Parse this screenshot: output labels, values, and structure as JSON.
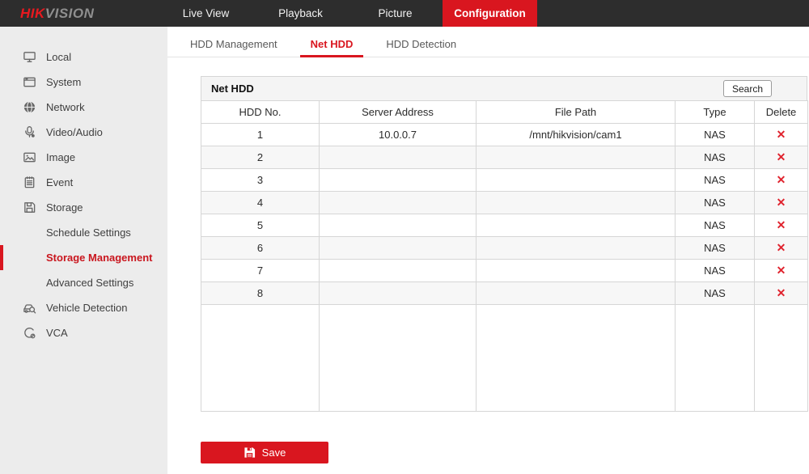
{
  "topnav": {
    "logo_hik": "HIK",
    "logo_vision": "VISION",
    "items": [
      {
        "label": "Live View",
        "active": false
      },
      {
        "label": "Playback",
        "active": false
      },
      {
        "label": "Picture",
        "active": false
      },
      {
        "label": "Configuration",
        "active": true
      }
    ]
  },
  "sidebar": {
    "items": [
      {
        "label": "Local",
        "icon": "monitor-icon"
      },
      {
        "label": "System",
        "icon": "window-icon"
      },
      {
        "label": "Network",
        "icon": "globe-icon"
      },
      {
        "label": "Video/Audio",
        "icon": "microphone-icon"
      },
      {
        "label": "Image",
        "icon": "image-icon"
      },
      {
        "label": "Event",
        "icon": "event-icon"
      },
      {
        "label": "Storage",
        "icon": "storage-icon"
      },
      {
        "label": "Schedule Settings",
        "sub": true
      },
      {
        "label": "Storage Management",
        "sub": true,
        "active": true
      },
      {
        "label": "Advanced Settings",
        "sub": true
      },
      {
        "label": "Vehicle Detection",
        "icon": "vehicle-detection-icon"
      },
      {
        "label": "VCA",
        "icon": "vca-icon"
      }
    ]
  },
  "tabs": [
    {
      "label": "HDD Management",
      "active": false
    },
    {
      "label": "Net HDD",
      "active": true
    },
    {
      "label": "HDD Detection",
      "active": false
    }
  ],
  "net_hdd": {
    "title": "Net HDD",
    "search_button": "Search",
    "table": {
      "columns": [
        "HDD No.",
        "Server Address",
        "File Path",
        "Type",
        "Delete"
      ],
      "delete_icon": "✕",
      "rows": [
        {
          "hdd_no": "1",
          "server_address": "10.0.0.7",
          "file_path": "/mnt/hikvision/cam1",
          "type": "NAS"
        },
        {
          "hdd_no": "2",
          "server_address": "",
          "file_path": "",
          "type": "NAS"
        },
        {
          "hdd_no": "3",
          "server_address": "",
          "file_path": "",
          "type": "NAS"
        },
        {
          "hdd_no": "4",
          "server_address": "",
          "file_path": "",
          "type": "NAS"
        },
        {
          "hdd_no": "5",
          "server_address": "",
          "file_path": "",
          "type": "NAS"
        },
        {
          "hdd_no": "6",
          "server_address": "",
          "file_path": "",
          "type": "NAS"
        },
        {
          "hdd_no": "7",
          "server_address": "",
          "file_path": "",
          "type": "NAS"
        },
        {
          "hdd_no": "8",
          "server_address": "",
          "file_path": "",
          "type": "NAS"
        }
      ]
    },
    "save_button": "Save"
  },
  "colors": {
    "accent_red": "#d9161f",
    "delete_red": "#e0232e",
    "topbar_bg": "#2d2d2d",
    "sidebar_bg": "#ececec"
  }
}
